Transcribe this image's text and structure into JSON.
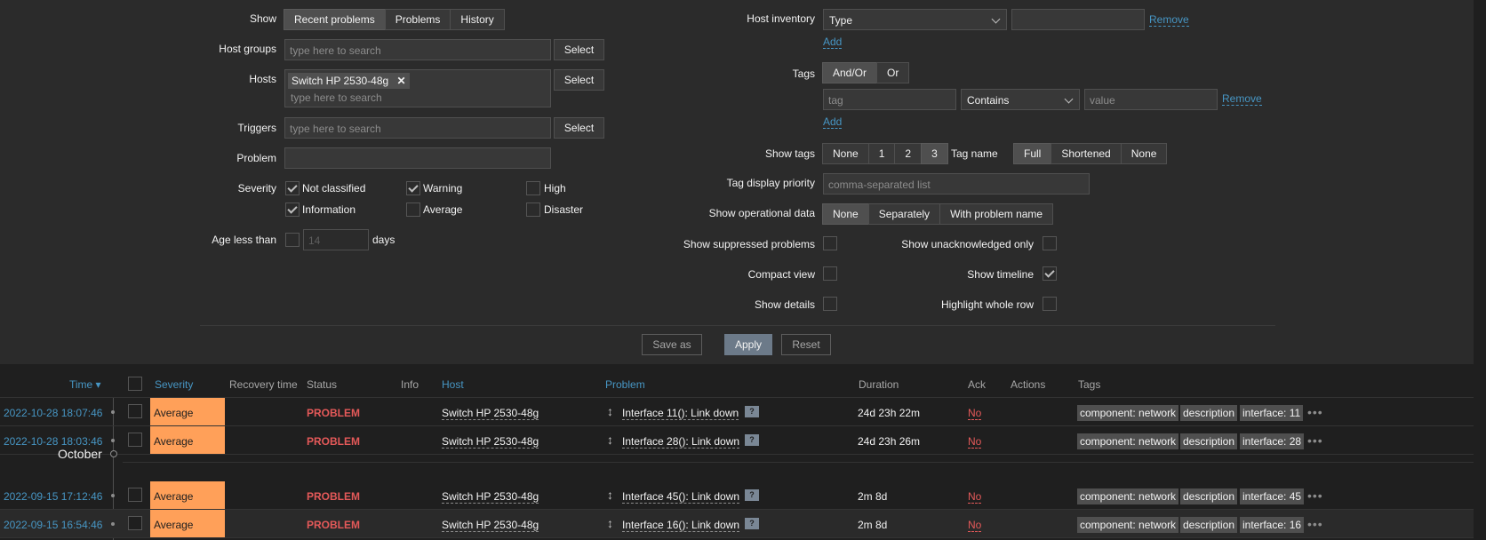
{
  "filter": {
    "show": {
      "label": "Show",
      "options": [
        "Recent problems",
        "Problems",
        "History"
      ],
      "active": "Recent problems"
    },
    "host_groups": {
      "label": "Host groups",
      "placeholder": "type here to search",
      "select": "Select"
    },
    "hosts": {
      "label": "Hosts",
      "chip": "Switch HP 2530-48g",
      "chip_close": "✕",
      "placeholder": "type here to search",
      "select": "Select"
    },
    "triggers": {
      "label": "Triggers",
      "placeholder": "type here to search",
      "select": "Select"
    },
    "problem": {
      "label": "Problem",
      "value": ""
    },
    "severity": {
      "label": "Severity",
      "items": [
        {
          "label": "Not classified",
          "checked": true
        },
        {
          "label": "Warning",
          "checked": true
        },
        {
          "label": "High",
          "checked": false
        },
        {
          "label": "Information",
          "checked": true
        },
        {
          "label": "Average",
          "checked": false
        },
        {
          "label": "Disaster",
          "checked": false
        }
      ]
    },
    "age": {
      "label": "Age less than",
      "value": "14",
      "unit": "days",
      "checked": false
    },
    "host_inventory": {
      "label": "Host inventory",
      "select": "Type",
      "value": "",
      "remove": "Remove",
      "add": "Add"
    },
    "tags": {
      "label": "Tags",
      "mode": [
        "And/Or",
        "Or"
      ],
      "active": "And/Or",
      "tag_placeholder": "tag",
      "operator": "Contains",
      "value_placeholder": "value",
      "remove": "Remove",
      "add": "Add"
    },
    "show_tags": {
      "label": "Show tags",
      "options": [
        "None",
        "1",
        "2",
        "3"
      ],
      "active": "3"
    },
    "tag_name": {
      "label": "Tag name",
      "options": [
        "Full",
        "Shortened",
        "None"
      ],
      "active": "Full"
    },
    "tag_priority": {
      "label": "Tag display priority",
      "placeholder": "comma-separated list"
    },
    "op_data": {
      "label": "Show operational data",
      "options": [
        "None",
        "Separately",
        "With problem name"
      ],
      "active": "None"
    },
    "show_suppressed": {
      "label": "Show suppressed problems",
      "checked": false
    },
    "unack_only": {
      "label": "Show unacknowledged only",
      "checked": false
    },
    "compact": {
      "label": "Compact view",
      "checked": false
    },
    "timeline": {
      "label": "Show timeline",
      "checked": true
    },
    "details": {
      "label": "Show details",
      "checked": false
    },
    "highlight": {
      "label": "Highlight whole row",
      "checked": false
    },
    "buttons": {
      "save_as": "Save as",
      "apply": "Apply",
      "reset": "Reset"
    }
  },
  "table": {
    "headers": {
      "time": "Time ▾",
      "severity": "Severity",
      "recovery": "Recovery time",
      "status": "Status",
      "info": "Info",
      "host": "Host",
      "problem": "Problem",
      "duration": "Duration",
      "ack": "Ack",
      "actions": "Actions",
      "tags": "Tags"
    },
    "month_label": "October",
    "rows": [
      {
        "time": "2022-10-28 18:07:46",
        "severity": "Average",
        "status": "PROBLEM",
        "host": "Switch HP 2530-48g",
        "problem": "Interface 11(): Link down",
        "duration": "24d 23h 22m",
        "ack": "No",
        "tags": [
          "component: network",
          "description",
          "interface: 11"
        ]
      },
      {
        "time": "2022-10-28 18:03:46",
        "severity": "Average",
        "status": "PROBLEM",
        "host": "Switch HP 2530-48g",
        "problem": "Interface 28(): Link down",
        "duration": "24d 23h 26m",
        "ack": "No",
        "tags": [
          "component: network",
          "description",
          "interface: 28"
        ]
      },
      {
        "time": "2022-09-15 17:12:46",
        "severity": "Average",
        "status": "PROBLEM",
        "host": "Switch HP 2530-48g",
        "problem": "Interface 45(): Link down",
        "duration": "2m 8d",
        "ack": "No",
        "tags": [
          "component: network",
          "description",
          "interface: 45"
        ]
      },
      {
        "time": "2022-09-15 16:54:46",
        "severity": "Average",
        "status": "PROBLEM",
        "host": "Switch HP 2530-48g",
        "problem": "Interface 16(): Link down",
        "duration": "2m 8d",
        "ack": "No",
        "tags": [
          "component: network",
          "description",
          "interface: 16"
        ]
      }
    ],
    "question_mark": "?",
    "more": "•••"
  },
  "colors": {
    "average": "#ffa059",
    "problem": "#e45959",
    "link": "#4796c4"
  }
}
